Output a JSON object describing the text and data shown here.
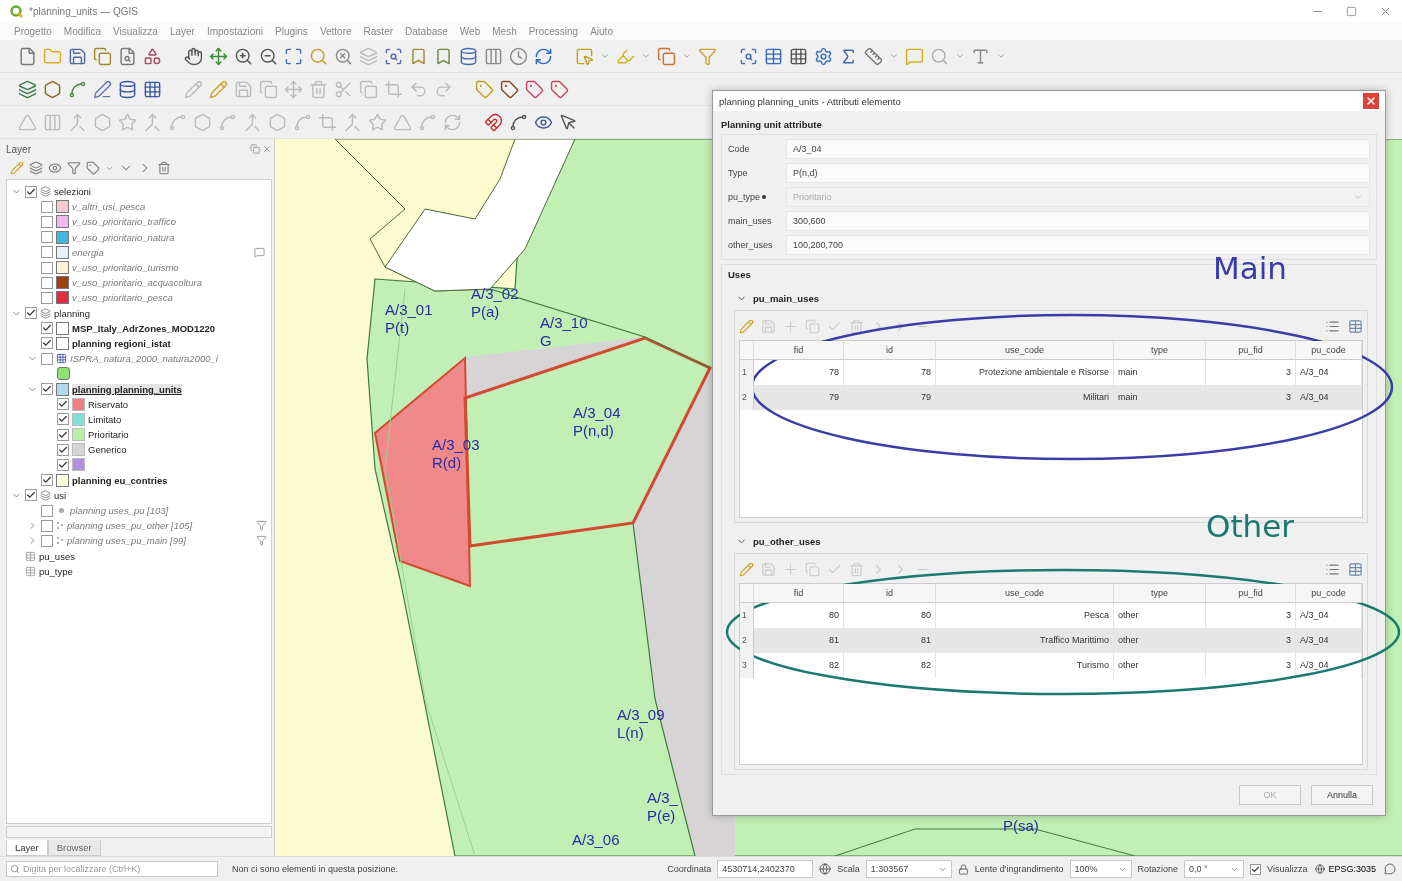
{
  "window": {
    "title": "*planning_units — QGIS"
  },
  "menu": [
    "Progetto",
    "Modifica",
    "Visualizza",
    "Layer",
    "Impostazioni",
    "Plugins",
    "Vettore",
    "Raster",
    "Database",
    "Web",
    "Mesh",
    "Processing",
    "Aiuto"
  ],
  "layers_panel": {
    "title": "Layer",
    "tree": [
      {
        "kind": "group",
        "label": "selezioni",
        "checked": true,
        "expanded": true,
        "selected": false,
        "children": [
          {
            "kind": "layer",
            "label": "v_altri_usi_pesca",
            "checked": false,
            "color": "#f6c8d0",
            "greyed": true,
            "selected": false
          },
          {
            "kind": "layer",
            "label": "v_uso_prioritario_traffico",
            "checked": false,
            "color": "#f0b8f0",
            "greyed": true,
            "selected": false
          },
          {
            "kind": "layer",
            "label": "v_uso_prioritario_natura",
            "checked": false,
            "color": "#40b8e0",
            "greyed": true,
            "selected": false
          },
          {
            "kind": "layer",
            "label": "energia",
            "checked": false,
            "color": "#e8f0ff",
            "greyed": true,
            "selected": false,
            "indicator": true
          },
          {
            "kind": "layer",
            "label": "v_uso_prioritario_turismo",
            "checked": false,
            "color": "#fff4d8",
            "greyed": true,
            "selected": false
          },
          {
            "kind": "layer",
            "label": "v_uso_prioritario_acquacoltura",
            "checked": false,
            "color": "#a04010",
            "greyed": true,
            "selected": false
          },
          {
            "kind": "layer",
            "label": "v_uso_prioritario_pesca",
            "checked": false,
            "color": "#e03040",
            "greyed": true,
            "selected": false
          }
        ]
      },
      {
        "kind": "group",
        "label": "planning",
        "checked": true,
        "expanded": true,
        "selected": false,
        "children": [
          {
            "kind": "layer",
            "label": "MSP_Italy_AdrZones_MOD1220",
            "checked": true,
            "color": "#ffffff",
            "greyed": false,
            "selected": false
          },
          {
            "kind": "layer",
            "label": "planning regioni_istat",
            "checked": true,
            "color": "#ffffff",
            "greyed": false,
            "selected": false
          },
          {
            "kind": "raster",
            "label": "ISPRA_natura_2000_natura2000_i",
            "checked": false,
            "expanded": true,
            "greyed": true,
            "selected": false,
            "children": [
              {
                "kind": "symbol",
                "color": "#8ee070"
              }
            ]
          },
          {
            "kind": "layer",
            "label": "planning planning_units",
            "checked": true,
            "expanded": true,
            "color": "#b0d8f0",
            "greyed": false,
            "selected": true,
            "children": [
              {
                "kind": "category",
                "label": "Riservato",
                "checked": true,
                "color": "#f08080"
              },
              {
                "kind": "category",
                "label": "Limitato",
                "checked": true,
                "color": "#80e0d8"
              },
              {
                "kind": "category",
                "label": "Prioritario",
                "checked": true,
                "color": "#b8f0a8"
              },
              {
                "kind": "category",
                "label": "Generico",
                "checked": true,
                "color": "#d4d4d4"
              },
              {
                "kind": "category",
                "checked": true,
                "color": "#b090e0"
              }
            ]
          },
          {
            "kind": "layer",
            "label": "planning eu_contries",
            "checked": true,
            "color": "#fdfde0",
            "greyed": false,
            "selected": false
          }
        ]
      },
      {
        "kind": "group",
        "label": "usi",
        "checked": true,
        "expanded": true,
        "selected": false,
        "children": [
          {
            "kind": "point_layer",
            "label": "planning uses_pu [103]",
            "checked": false,
            "greyed": true,
            "selected": false
          },
          {
            "kind": "layer",
            "label": "planning uses_pu_other [105]",
            "checked": false,
            "expanded": false,
            "greyed": true,
            "selected": false,
            "filtered": true
          },
          {
            "kind": "layer",
            "label": "planning uses_pu_main [99]",
            "checked": false,
            "expanded": false,
            "greyed": true,
            "selected": false,
            "filtered": true
          }
        ]
      },
      {
        "kind": "table",
        "label": "pu_uses",
        "selected": false
      },
      {
        "kind": "table",
        "label": "pu_type",
        "selected": false
      }
    ],
    "tabs": [
      {
        "label": "Layer",
        "selected": true
      },
      {
        "label": "Browser",
        "selected": false
      }
    ]
  },
  "map": {
    "labels": [
      {
        "code": "A/3_01",
        "type": "P(t)"
      },
      {
        "code": "A/3_02",
        "type": "P(a)"
      },
      {
        "code": "A/3_10",
        "type": "G"
      },
      {
        "code": "A/3_04",
        "type": "P(n,d)"
      },
      {
        "code": "A/3_03",
        "type": "R(d)"
      },
      {
        "code": "A/3_09",
        "type": "L(n)"
      },
      {
        "code": "A/3_",
        "type": "P(e)"
      },
      {
        "code": "A/3_06"
      },
      {
        "type": "P(sa)"
      }
    ]
  },
  "dialog": {
    "title": "planning planning_units - Attributi elemento",
    "section": "Planning unit attribute",
    "fields": [
      {
        "kind": "text",
        "label": "Code",
        "value": "A/3_04",
        "disabled": false,
        "required": false
      },
      {
        "kind": "text",
        "label": "Type",
        "value": "P(n,d)",
        "disabled": false,
        "required": false
      },
      {
        "kind": "combo",
        "label": "pu_type",
        "value": "Prioritario",
        "disabled": true,
        "required": true
      },
      {
        "kind": "text",
        "label": "main_uses",
        "value": "300,600",
        "disabled": false,
        "required": false
      },
      {
        "kind": "text",
        "label": "other_uses",
        "value": "100,200,700",
        "disabled": false,
        "required": false
      }
    ],
    "group_title": "Uses",
    "subforms": [
      {
        "title": "pu_main_uses",
        "expanded": true,
        "columns": [
          "fid",
          "id",
          "use_code",
          "type",
          "pu_fid",
          "pu_code"
        ],
        "rows": [
          {
            "number": "1",
            "cells": [
              "78",
              "78",
              "Protezione ambientale e Risorse",
              "main",
              "3",
              "A/3_04"
            ]
          },
          {
            "number": "2",
            "cells": [
              "79",
              "79",
              "Militari",
              "main",
              "3",
              "A/3_04"
            ]
          }
        ]
      },
      {
        "title": "pu_other_uses",
        "expanded": true,
        "columns": [
          "fid",
          "id",
          "use_code",
          "type",
          "pu_fid",
          "pu_code"
        ],
        "rows": [
          {
            "number": "1",
            "cells": [
              "80",
              "80",
              "Pesca",
              "other",
              "3",
              "A/3_04"
            ]
          },
          {
            "number": "2",
            "cells": [
              "81",
              "81",
              "Traffico Marittimo",
              "other",
              "3",
              "A/3_04"
            ]
          },
          {
            "number": "3",
            "cells": [
              "82",
              "82",
              "Turismo",
              "other",
              "3",
              "A/3_04"
            ]
          }
        ]
      }
    ],
    "buttons": [
      {
        "label": "OK",
        "disabled": true
      },
      {
        "label": "Annulla",
        "disabled": false
      }
    ]
  },
  "annotations": [
    {
      "text": "Main",
      "color": "#3c3ca8"
    },
    {
      "text": "Other",
      "color": "#1b7a6e"
    }
  ],
  "status_bar": {
    "search": {
      "placeholder": "Digita per localizzare (Ctrl+K)"
    },
    "message": "Non ci sono elementi in questa posizione.",
    "coordinate_label": "Coordinata",
    "coordinate": "4530714,2402370",
    "scale_label": "Scala",
    "scale": "1:303567",
    "magnifier_label": "Lente d'ingrandimento",
    "magnifier": "100%",
    "rotation_label": "Rotazione",
    "rotation": "0,0 °",
    "render_label": "Visualizza",
    "render_checked": true,
    "crs": "EPSG:3035"
  }
}
